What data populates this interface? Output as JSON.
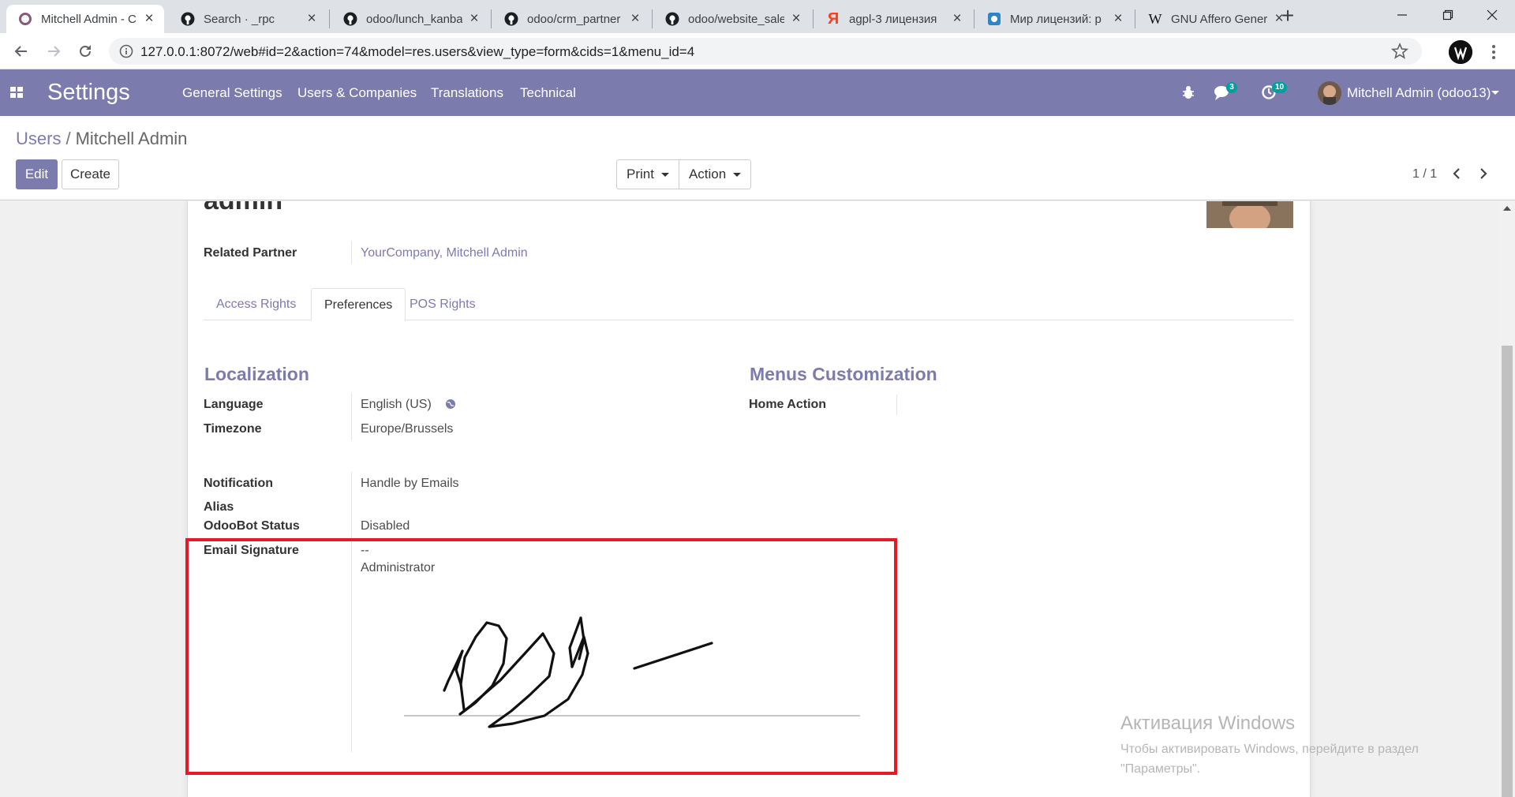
{
  "browser": {
    "tabs": [
      {
        "title": "Mitchell Admin - C",
        "icon": "odoo-icon",
        "active": true
      },
      {
        "title": "Search · _rpc",
        "icon": "github-icon"
      },
      {
        "title": "odoo/lunch_kanba",
        "icon": "github-icon"
      },
      {
        "title": "odoo/crm_partner",
        "icon": "github-icon"
      },
      {
        "title": "odoo/website_sale",
        "icon": "github-icon"
      },
      {
        "title": "agpl-3 лицензия",
        "icon": "yandex-icon"
      },
      {
        "title": "Мир лицензий: р",
        "icon": "site-icon"
      },
      {
        "title": "GNU Affero Gener",
        "icon": "wikipedia-icon"
      }
    ],
    "url": "127.0.0.1:8072/web#id=2&action=74&model=res.users&view_type=form&cids=1&menu_id=4"
  },
  "topnav": {
    "app_name": "Settings",
    "menus": [
      "General Settings",
      "Users & Companies",
      "Translations",
      "Technical"
    ],
    "messages_count": "3",
    "activities_count": "10",
    "user_name": "Mitchell Admin (odoo13)"
  },
  "control_panel": {
    "breadcrumb_parent": "Users",
    "breadcrumb_sep": "/",
    "breadcrumb_current": "Mitchell Admin",
    "edit_label": "Edit",
    "create_label": "Create",
    "print_label": "Print",
    "action_label": "Action",
    "pager": "1 / 1"
  },
  "form": {
    "title_cut": "admin",
    "related_partner_label": "Related Partner",
    "related_partner_value": "YourCompany, Mitchell Admin",
    "tabs": [
      "Access Rights",
      "Preferences",
      "POS Rights"
    ],
    "active_tab": "Preferences",
    "localization": {
      "heading": "Localization",
      "language_label": "Language",
      "language_value": "English (US)",
      "timezone_label": "Timezone",
      "timezone_value": "Europe/Brussels"
    },
    "menus_customization": {
      "heading": "Menus Customization",
      "home_action_label": "Home Action"
    },
    "notification_label": "Notification",
    "notification_value": "Handle by Emails",
    "alias_label": "Alias",
    "odoobot_label": "OdooBot Status",
    "odoobot_value": "Disabled",
    "signature_label": "Email Signature",
    "signature_line1": "--",
    "signature_line2": "Administrator"
  },
  "watermark": {
    "line1": "Активация Windows",
    "line2": "Чтобы активировать Windows, перейдите в раздел",
    "line3": "\"Параметры\"."
  },
  "colors": {
    "brand": "#7c7bad",
    "highlight_box": "#e51a24",
    "badge": "#00a09d"
  }
}
